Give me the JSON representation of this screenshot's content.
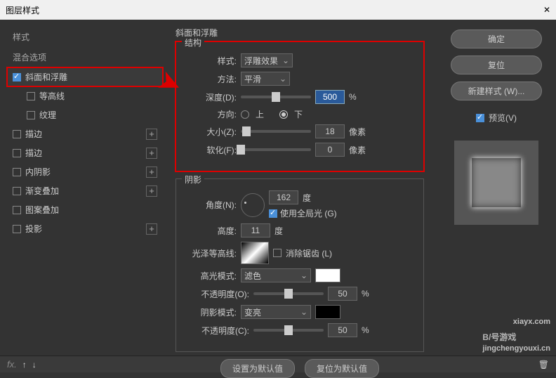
{
  "title": "图层样式",
  "sidebar": {
    "head1": "样式",
    "head2": "混合选项",
    "items": [
      {
        "label": "斜面和浮雕",
        "checked": true,
        "selected": true
      },
      {
        "label": "等高线",
        "checked": false,
        "indent": true
      },
      {
        "label": "纹理",
        "checked": false,
        "indent": true
      },
      {
        "label": "描边",
        "checked": false,
        "fx": true
      },
      {
        "label": "描边",
        "checked": false,
        "fx": true
      },
      {
        "label": "内阴影",
        "checked": false,
        "fx": true
      },
      {
        "label": "渐变叠加",
        "checked": false,
        "fx": true
      },
      {
        "label": "图案叠加",
        "checked": false
      },
      {
        "label": "投影",
        "checked": false,
        "fx": true
      }
    ]
  },
  "panel": {
    "title": "斜面和浮雕",
    "struct": {
      "legend": "结构",
      "styleLabel": "样式:",
      "styleValue": "浮雕效果",
      "methodLabel": "方法:",
      "methodValue": "平滑",
      "depthLabel": "深度(D):",
      "depthValue": "500",
      "depthUnit": "%",
      "dirLabel": "方向:",
      "up": "上",
      "down": "下",
      "sizeLabel": "大小(Z):",
      "sizeValue": "18",
      "sizeUnit": "像素",
      "softLabel": "软化(F):",
      "softValue": "0",
      "softUnit": "像素"
    },
    "shadow": {
      "legend": "阴影",
      "angleLabel": "角度(N):",
      "angleValue": "162",
      "angleUnit": "度",
      "globalLabel": "使用全局光 (G)",
      "altLabel": "高度:",
      "altValue": "11",
      "altUnit": "度",
      "glossLabel": "光泽等高线:",
      "antiLabel": "消除锯齿 (L)",
      "hiModeLabel": "高光模式:",
      "hiModeValue": "滤色",
      "hiOpLabel": "不透明度(O):",
      "hiOpValue": "50",
      "hiOpUnit": "%",
      "shModeLabel": "阴影模式:",
      "shModeValue": "变亮",
      "shOpLabel": "不透明度(C):",
      "shOpValue": "50",
      "shOpUnit": "%"
    },
    "defaultBtn": "设置为默认值",
    "resetBtn": "复位为默认值"
  },
  "right": {
    "ok": "确定",
    "reset": "复位",
    "newStyle": "新建样式 (W)...",
    "previewLabel": "预览(V)"
  },
  "watermark": {
    "main": "B/号游戏",
    "sub": "xiayx.com",
    "sub2": "jingchengyouxi.cn"
  }
}
